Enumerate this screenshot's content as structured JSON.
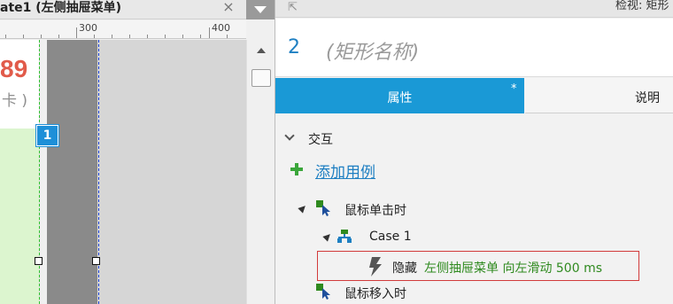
{
  "editor": {
    "tab_title": "ate1 (左侧抽屉菜单)",
    "tab_close": "×",
    "ruler": {
      "labels": [
        "300",
        "400"
      ]
    },
    "canvas": {
      "big_number": "89",
      "small_text": "卡 )",
      "marker_label": "1"
    }
  },
  "inspector": {
    "header_title": "检视: 矩形",
    "shape": {
      "number": "2",
      "name_placeholder": "(矩形名称)"
    },
    "tabs": {
      "properties": "属性",
      "properties_modified_mark": "*",
      "notes": "说明"
    },
    "interactions": {
      "section_label": "交互",
      "add_case_label": "添加用例",
      "events": [
        {
          "label": "鼠标单击时",
          "icon": "click-event-icon"
        },
        {
          "label": "鼠标移入时",
          "icon": "mouse-enter-event-icon"
        }
      ],
      "case": {
        "label": "Case 1",
        "icon": "case-tree-icon"
      },
      "action": {
        "verb": "隐藏",
        "detail": "左侧抽屉菜单 向左滑动 500 ms",
        "icon": "lightning-icon"
      }
    }
  },
  "colors": {
    "accent_blue": "#1a99d6",
    "link_blue": "#1e7fc2",
    "action_green": "#2f8a1f",
    "highlight_red": "#d23b3b",
    "number_red": "#e15b4a"
  }
}
